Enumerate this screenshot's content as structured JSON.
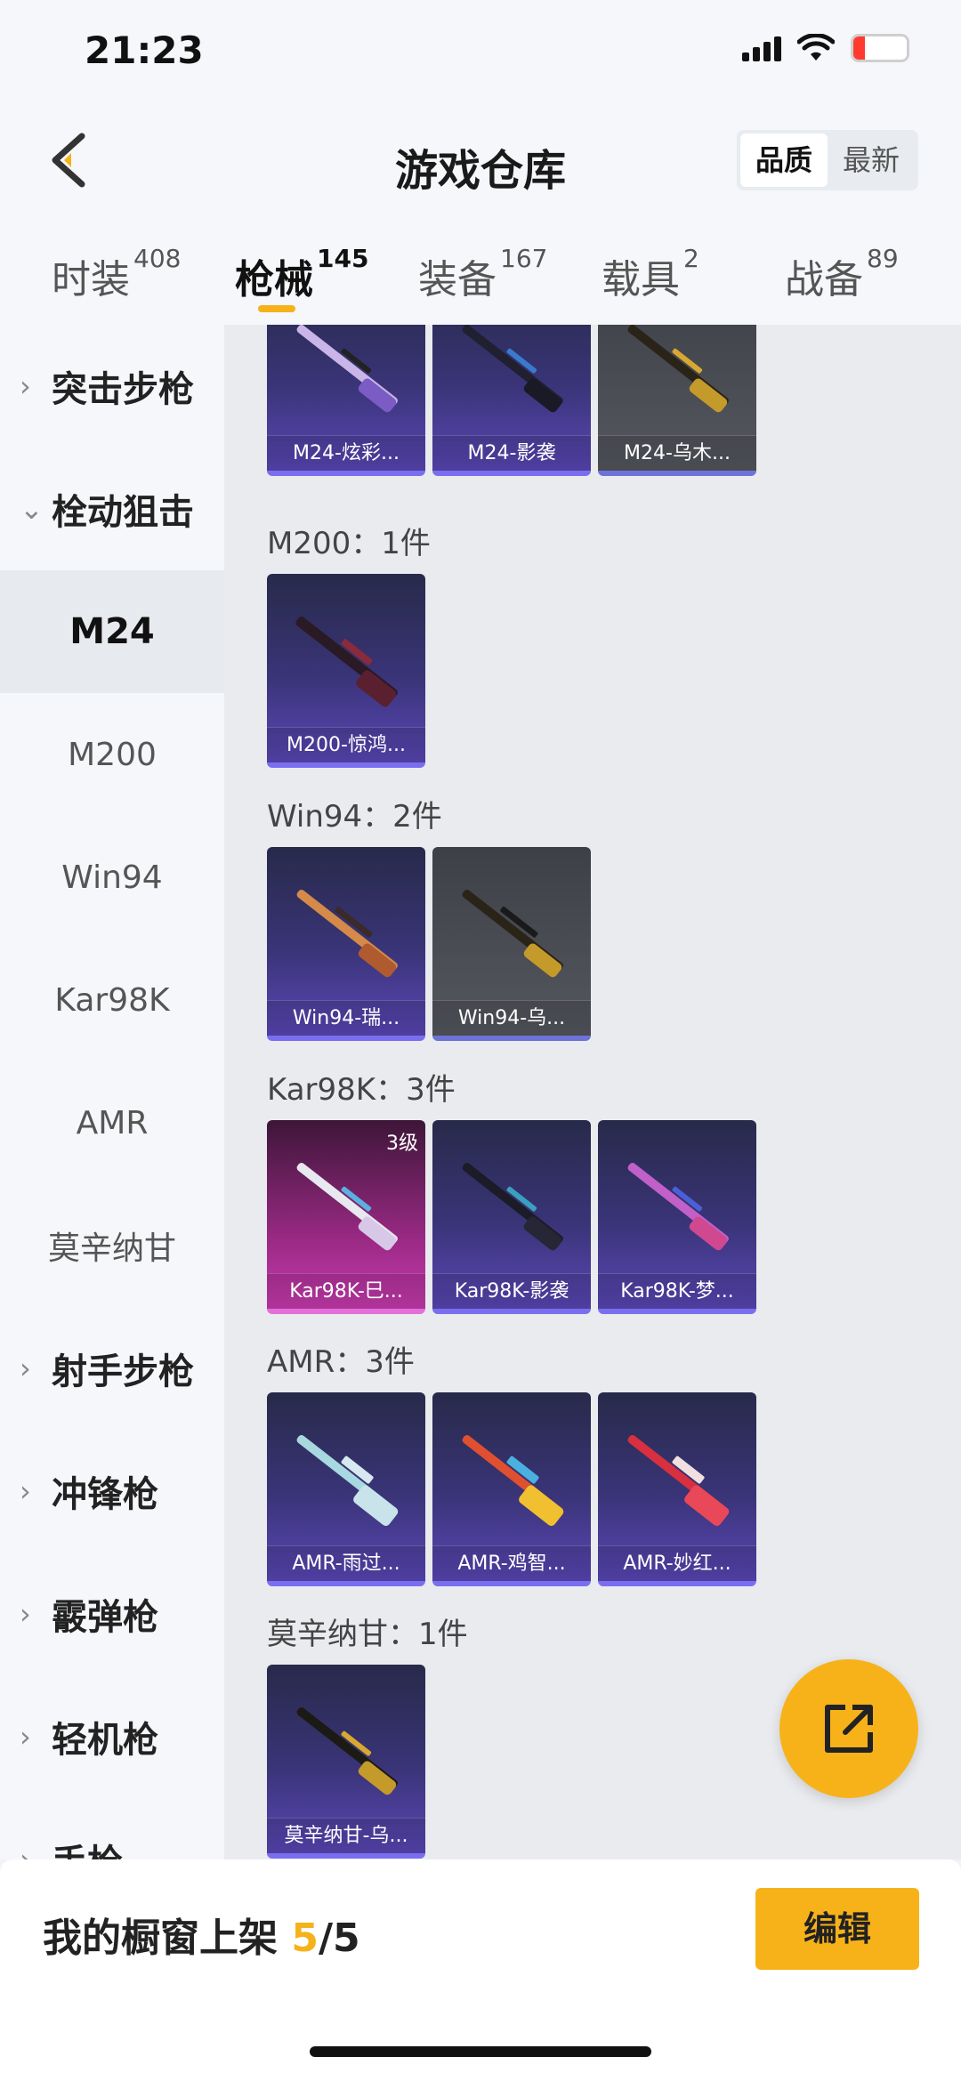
{
  "status_bar": {
    "time": "21:23",
    "battery": "18"
  },
  "header": {
    "title": "游戏仓库",
    "sort_options": [
      "品质",
      "最新"
    ],
    "sort_active": "品质"
  },
  "tabs": [
    {
      "label": "时装",
      "count": "408"
    },
    {
      "label": "枪械",
      "count": "145"
    },
    {
      "label": "装备",
      "count": "167"
    },
    {
      "label": "载具",
      "count": "2"
    },
    {
      "label": "战备",
      "count": "89"
    }
  ],
  "sidebar": {
    "items": [
      {
        "label": "突击步枪",
        "type": "group"
      },
      {
        "label": "栓动狙击",
        "type": "group-open"
      },
      {
        "label": "M24",
        "type": "sub",
        "active": true
      },
      {
        "label": "M200",
        "type": "sub"
      },
      {
        "label": "Win94",
        "type": "sub"
      },
      {
        "label": "Kar98K",
        "type": "sub"
      },
      {
        "label": "AMR",
        "type": "sub"
      },
      {
        "label": "莫辛纳甘",
        "type": "sub"
      },
      {
        "label": "射手步枪",
        "type": "group"
      },
      {
        "label": "冲锋枪",
        "type": "group"
      },
      {
        "label": "霰弹枪",
        "type": "group"
      },
      {
        "label": "轻机枪",
        "type": "group"
      },
      {
        "label": "手枪",
        "type": "group"
      }
    ]
  },
  "groups": {
    "m24": {
      "items": [
        {
          "name": "M24-炫彩...",
          "style": "purple"
        },
        {
          "name": "M24-影袭",
          "style": "purple"
        },
        {
          "name": "M24-乌木...",
          "style": "gray"
        }
      ]
    },
    "m200": {
      "label": "M200：1件",
      "items": [
        {
          "name": "M200-惊鸿...",
          "style": "purple"
        }
      ]
    },
    "win94": {
      "label": "Win94：2件",
      "items": [
        {
          "name": "Win94-瑞...",
          "style": "purple"
        },
        {
          "name": "Win94-乌...",
          "style": "gray"
        }
      ]
    },
    "kar98k": {
      "label": "Kar98K：3件",
      "items": [
        {
          "name": "Kar98K-巳...",
          "style": "pink",
          "badge": "3级"
        },
        {
          "name": "Kar98K-影袭",
          "style": "purple"
        },
        {
          "name": "Kar98K-梦...",
          "style": "purple"
        }
      ]
    },
    "amr": {
      "label": "AMR：3件",
      "items": [
        {
          "name": "AMR-雨过...",
          "style": "purple"
        },
        {
          "name": "AMR-鸡智...",
          "style": "purple"
        },
        {
          "name": "AMR-妙红...",
          "style": "purple"
        }
      ]
    },
    "mosin": {
      "label": "莫辛纳甘：1件",
      "items": [
        {
          "name": "莫辛纳甘-乌...",
          "style": "purple"
        }
      ]
    }
  },
  "bottom_bar": {
    "label": "我的橱窗上架",
    "current": "5",
    "total": "/5",
    "edit_label": "编辑"
  },
  "colors": {
    "accent": "#f7b21a",
    "card_purple": "#3a3478",
    "card_pink": "#9c2a86"
  }
}
